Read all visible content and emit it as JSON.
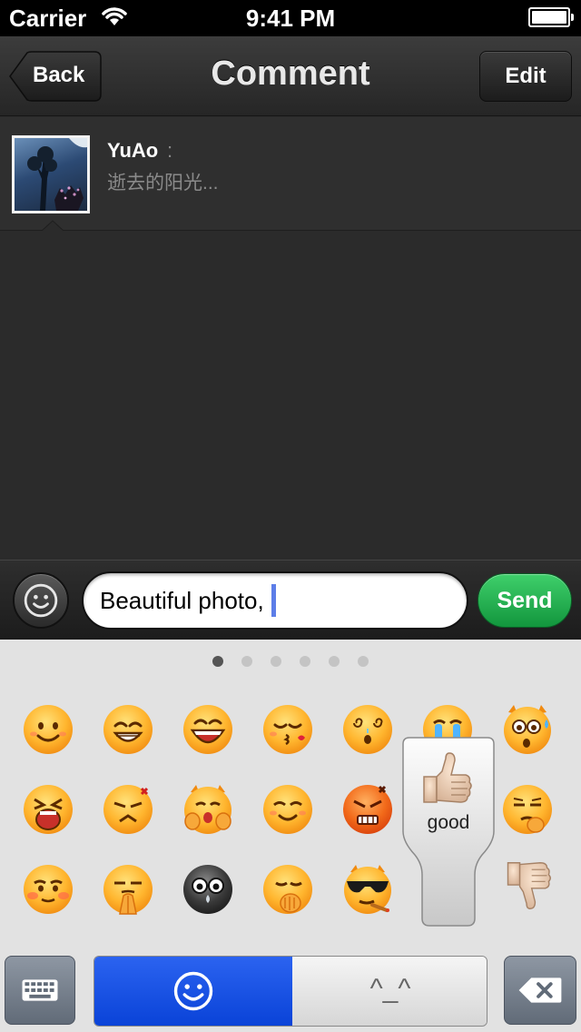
{
  "status": {
    "carrier": "Carrier",
    "time": "9:41 PM"
  },
  "nav": {
    "title": "Comment",
    "back_label": "Back",
    "edit_label": "Edit"
  },
  "post": {
    "author": "YuAo",
    "colon": ":",
    "snippet": "逝去的阳光..."
  },
  "composer": {
    "text": "Beautiful photo,",
    "send_label": "Send"
  },
  "keyboard": {
    "pages": 6,
    "active_page": 1,
    "preview_label": "good",
    "kaomoji_tab_label": "^_^",
    "active_tab": "emoji"
  },
  "colors": {
    "send_green": "#1aa548",
    "selected_tab_blue": "#1a4fe6",
    "cursor_blue": "#5d7ee8"
  }
}
